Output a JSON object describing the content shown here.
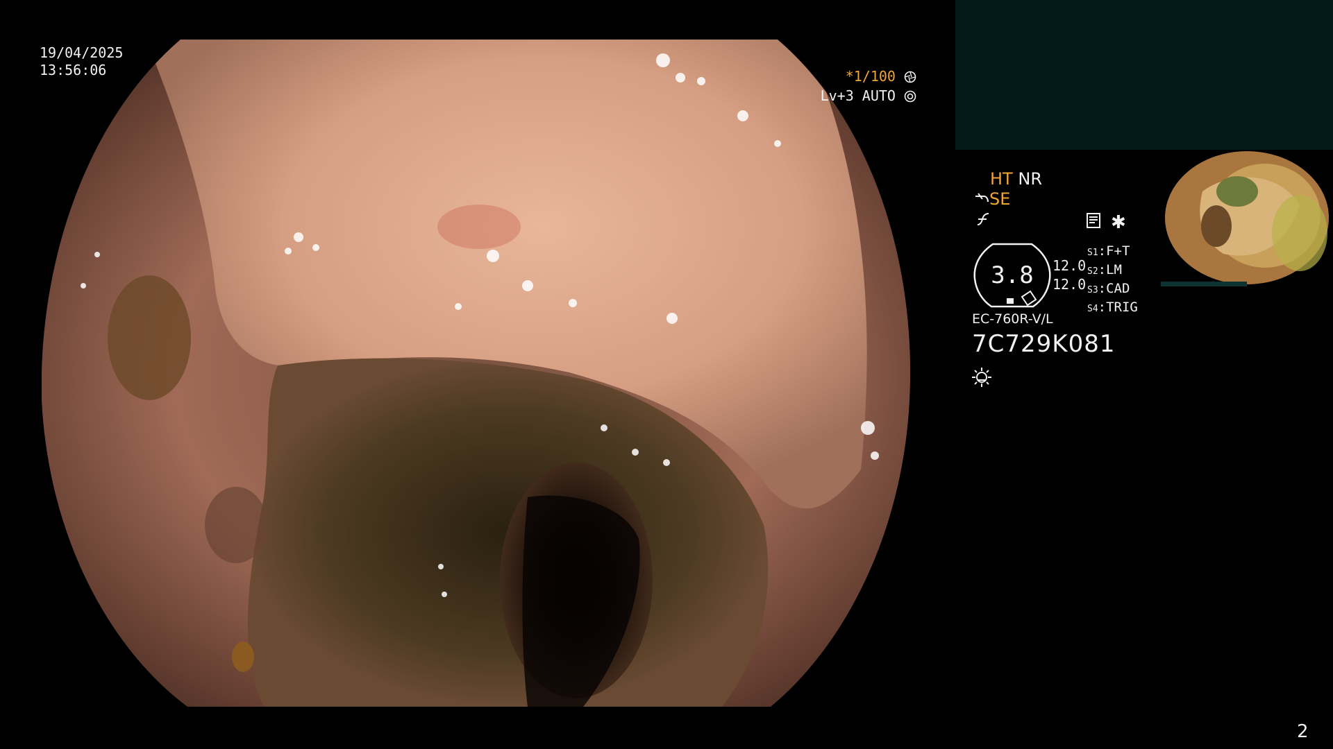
{
  "datetime": {
    "date": "19/04/2025",
    "time": "13:56:06"
  },
  "shutter": {
    "prefix": "*",
    "value": "1/100"
  },
  "level": {
    "text": "Lv+3 AUTO"
  },
  "modes": {
    "ht": "HT",
    "nr": "NR",
    "se": "SE"
  },
  "gauge": {
    "value": "3.8"
  },
  "readings": [
    "12.0",
    "12.0"
  ],
  "switches": [
    {
      "key": "S1",
      "value": "F+T"
    },
    {
      "key": "S2",
      "value": "LM"
    },
    {
      "key": "S3",
      "value": "CAD"
    },
    {
      "key": "S4",
      "value": "TRIG"
    }
  ],
  "scope": {
    "model": "EC-760R-V/L",
    "serial": "7C729K081"
  },
  "page_number": "2",
  "icons": [
    "iris-icon",
    "auto-iris-icon",
    "scope-bend-icon",
    "f-curve-icon",
    "document-icon",
    "asterisk-icon",
    "light-icon"
  ],
  "colors": {
    "accent": "#f0a436",
    "panel": "#041a1a",
    "text": "#f2f2f2"
  }
}
